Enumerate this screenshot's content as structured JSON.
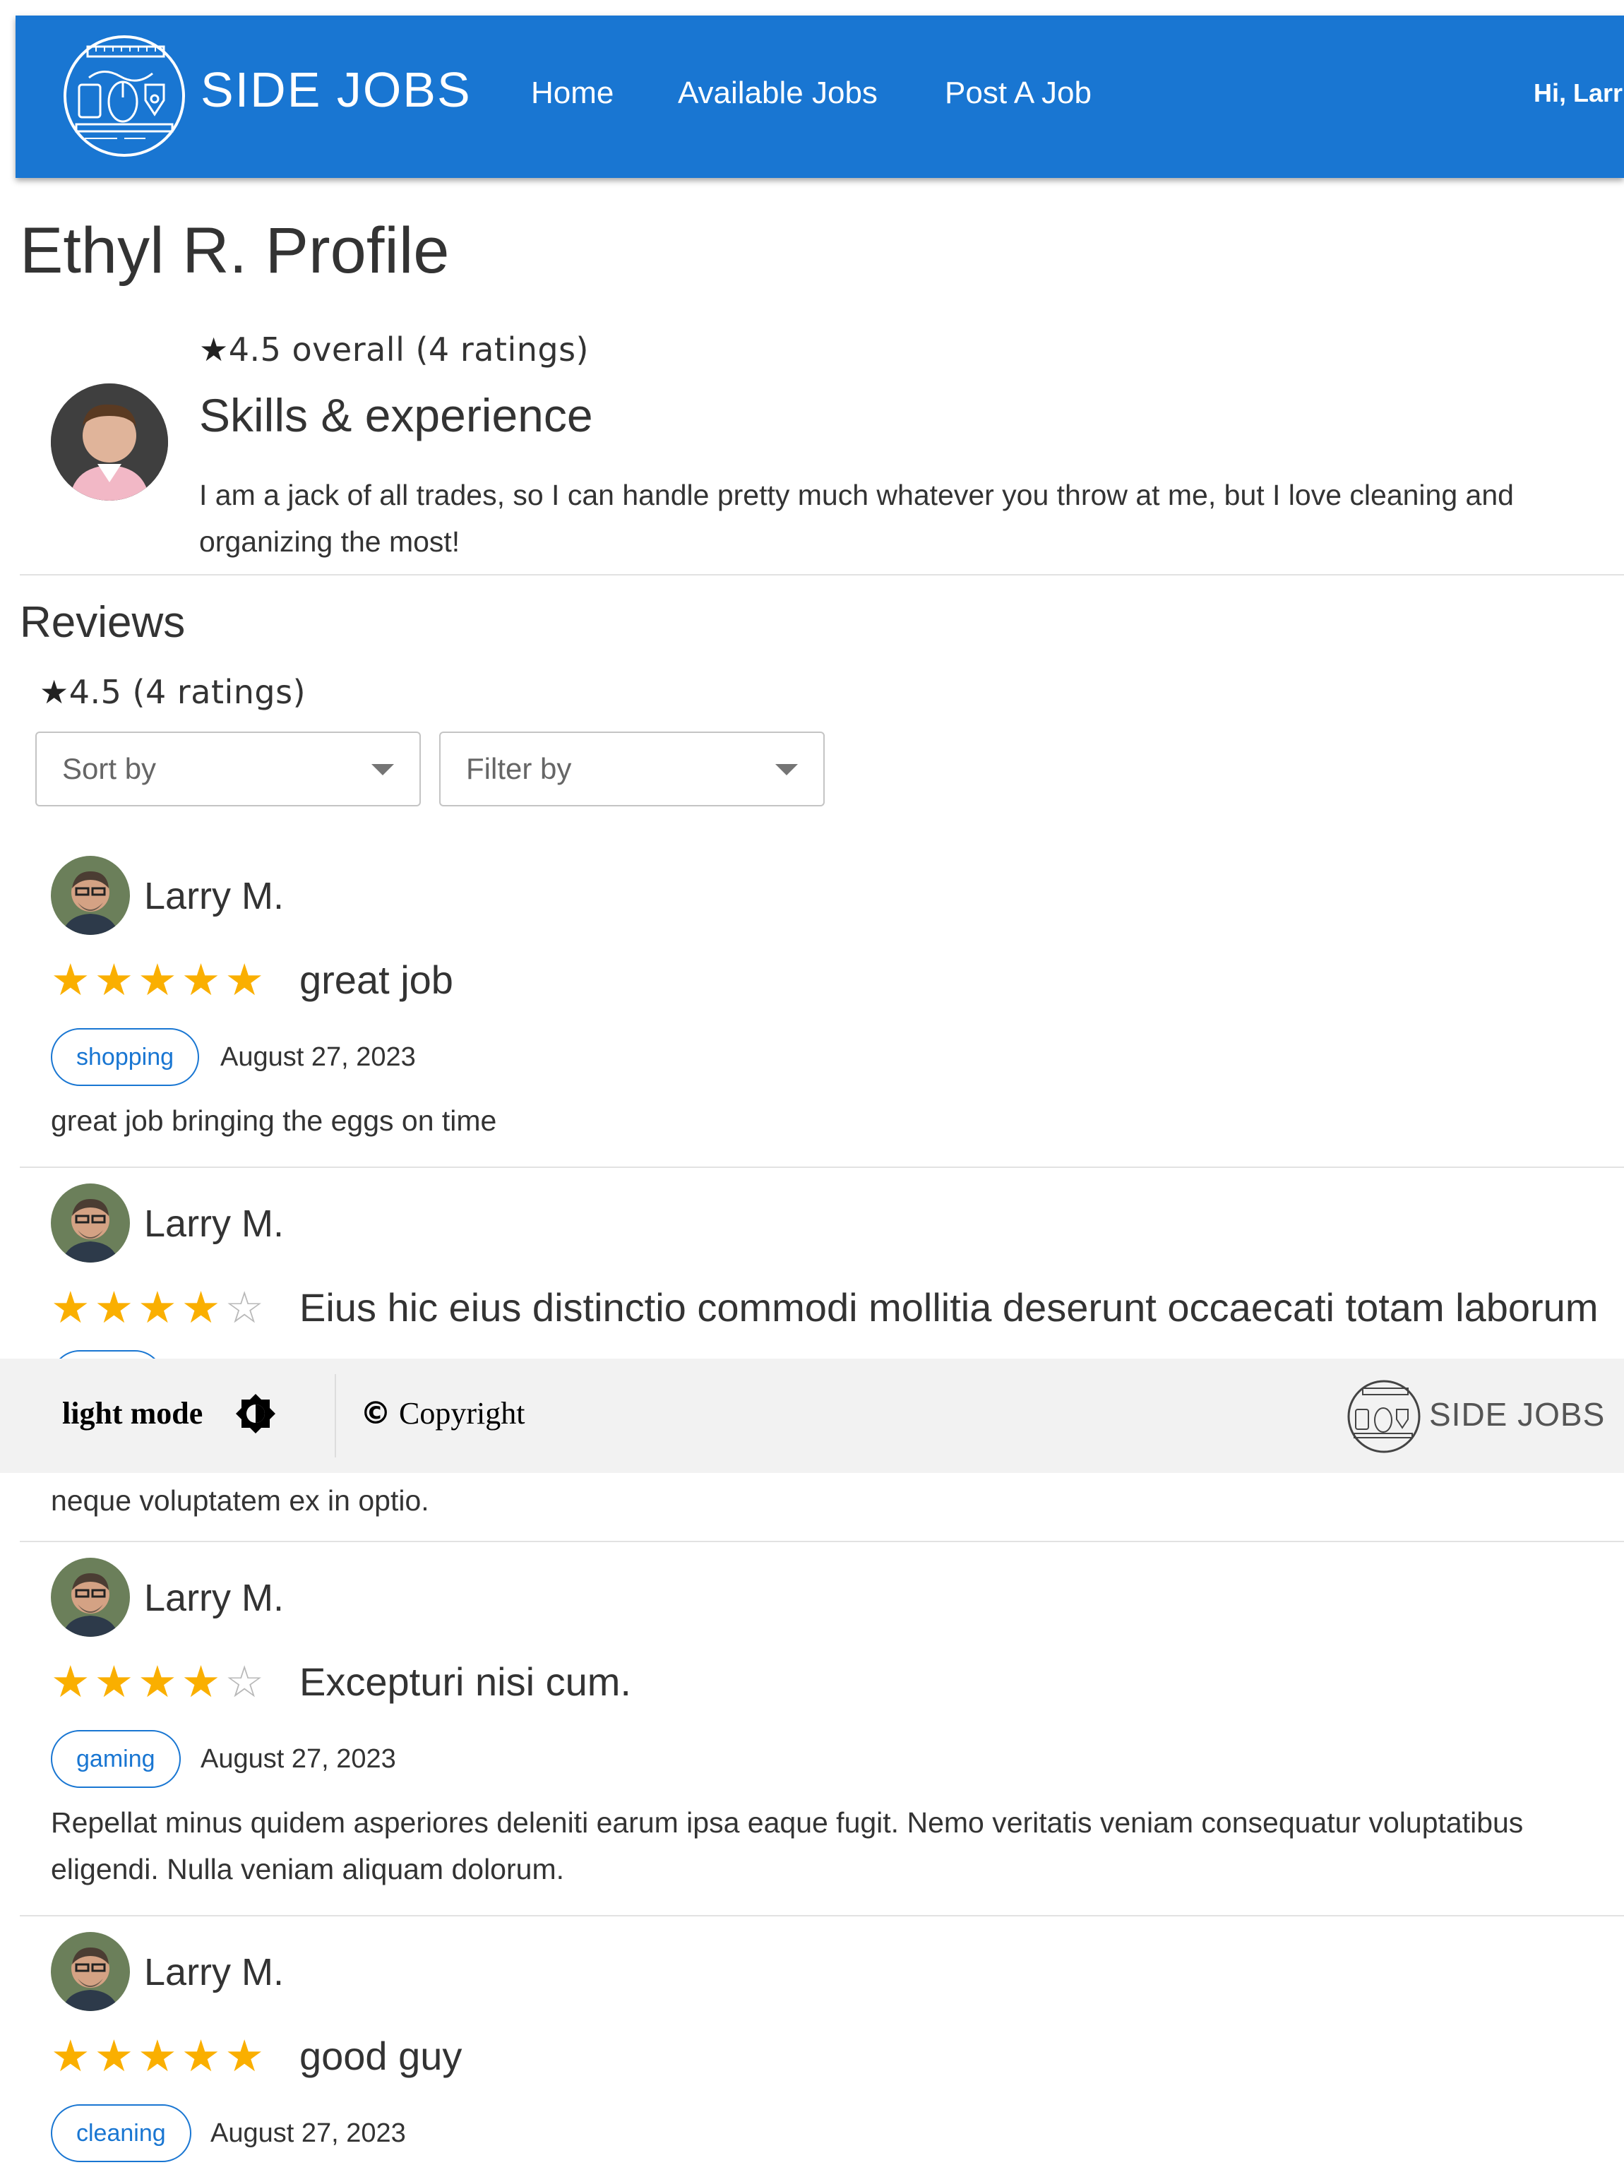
{
  "header": {
    "brand": "SIDE JOBS",
    "nav": [
      "Home",
      "Available Jobs",
      "Post A Job"
    ],
    "greeting": "Hi, Larr"
  },
  "profile": {
    "title": "Ethyl R. Profile",
    "star": "★",
    "overall": "4.5 overall (4 ratings)",
    "skills_heading": "Skills & experience",
    "bio": "I am a jack of all trades, so I can handle pretty much whatever you throw at me, but I love cleaning and organizing the most!"
  },
  "reviews": {
    "heading": "Reviews",
    "star": "★",
    "summary": "4.5 (4 ratings)",
    "sort_label": "Sort by",
    "filter_label": "Filter by",
    "items": [
      {
        "name": "Larry M.",
        "rating": 5,
        "stars_text": "★★★★★",
        "title": "great job",
        "tag": "shopping",
        "date": "August 27, 2023",
        "body": "great job bringing the eggs on time"
      },
      {
        "name": "Larry M.",
        "rating": 4,
        "stars_full": "★★★★",
        "stars_empty": "☆",
        "title": "Eius hic eius distinctio commodi mollitia deserunt occaecati totam laborum",
        "body_visible": "neque voluptatem ex in optio."
      },
      {
        "name": "Larry M.",
        "rating": 4,
        "stars_full": "★★★★",
        "stars_empty": "☆",
        "title": "Excepturi nisi cum.",
        "tag": "gaming",
        "date": "August 27, 2023",
        "body": "Repellat minus quidem asperiores deleniti earum ipsa eaque fugit. Nemo veritatis veniam consequatur voluptatibus eligendi. Nulla veniam aliquam dolorum."
      },
      {
        "name": "Larry M.",
        "rating": 5,
        "stars_text": "★★★★★",
        "title": "good guy",
        "tag": "cleaning",
        "date": "August 27, 2023"
      }
    ]
  },
  "footer": {
    "mode_label": "light mode",
    "copyright_symbol": "©",
    "copyright": "Copyright",
    "brand": "SIDE JOBS"
  },
  "colors": {
    "primary": "#1976d2",
    "star": "#faaf00",
    "footer_bg": "#f2f2f2"
  },
  "icons": [
    "side-jobs-logo-icon",
    "star-icon",
    "chevron-down-icon",
    "brightness-icon",
    "copyright-icon",
    "avatar"
  ]
}
